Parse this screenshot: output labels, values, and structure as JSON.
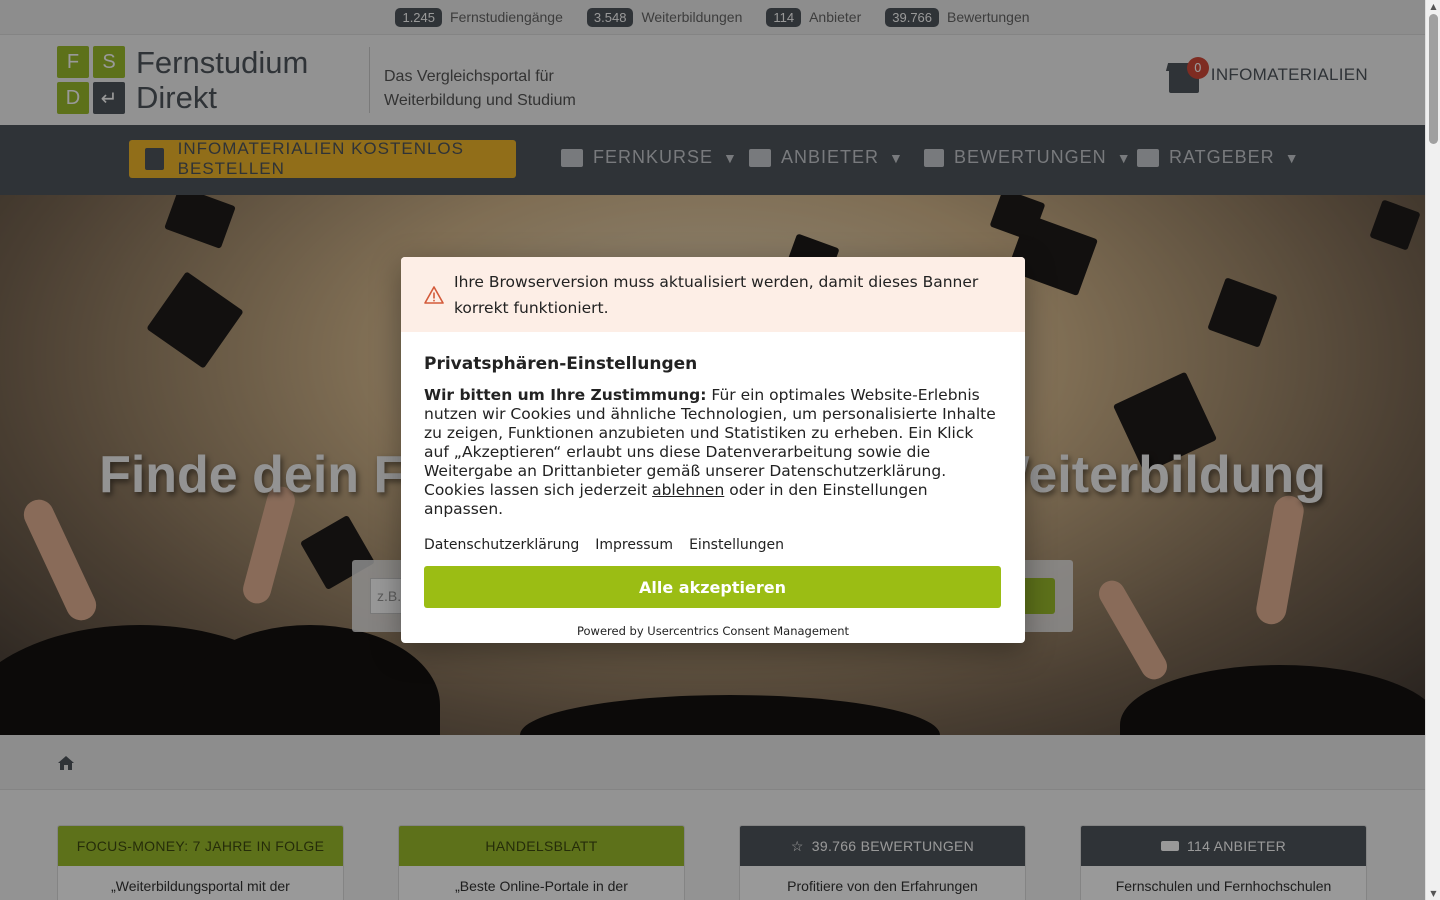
{
  "stats": [
    {
      "num": "1.245",
      "label": "Fernstudiengänge"
    },
    {
      "num": "3.548",
      "label": "Weiterbildungen"
    },
    {
      "num": "114",
      "label": "Anbieter"
    },
    {
      "num": "39.766",
      "label": "Bewertungen"
    }
  ],
  "logo": {
    "letters": [
      "F",
      "S",
      "D",
      "↵"
    ],
    "line1": "Fernstudium",
    "line2": "Direkt"
  },
  "tagline": {
    "line1": "Das Vergleichsportal für",
    "line2": "Weiterbildung und Studium"
  },
  "infomaterial": {
    "label": "INFOMATERIALIEN",
    "count": "0"
  },
  "nav": {
    "cta": "INFOMATERIALIEN KOSTENLOS BESTELLEN",
    "items": [
      "FERNKURSE",
      "ANBIETER",
      "BEWERTUNGEN",
      "RATGEBER"
    ]
  },
  "hero": {
    "title": "Finde dein Fernstudium oder deine Weiterbildung",
    "search_placeholder": "z.B."
  },
  "cards": [
    {
      "head": "FOCUS-MONEY: 7 JAHRE IN FOLGE",
      "body": "„Weiterbildungsportal mit der"
    },
    {
      "head": "HANDELSBLATT",
      "body": "„Beste Online-Portale in der"
    },
    {
      "head": "39.766 BEWERTUNGEN",
      "body": "Profitiere von den Erfahrungen"
    },
    {
      "head": "114 ANBIETER",
      "body": "Fernschulen und Fernhochschulen"
    }
  ],
  "modal": {
    "warning": "Ihre Browserversion muss aktualisiert werden, damit dieses Banner korrekt funktioniert.",
    "title": "Privatsphären-Einstellungen",
    "lead": "Wir bitten um Ihre Zustimmung:",
    "text1": " Für ein optimales Website-Erlebnis nutzen wir Cookies und ähnliche Technologien, um personalisierte Inhalte zu zeigen, Funktionen anzubieten und Statistiken zu erheben. Ein Klick auf „Akzeptieren“ erlaubt uns diese Datenverarbeitung sowie die Weitergabe an Drittanbieter gemäß unserer Datenschutzerklärung. Cookies lassen sich jederzeit ",
    "reject_link": "ablehnen",
    "text2": " oder in den Einstellungen anpassen.",
    "links": [
      "Datenschutzerklärung",
      "Impressum",
      "Einstellungen"
    ],
    "accept": "Alle akzeptieren",
    "powered": "Powered by Usercentrics Consent Management"
  },
  "colors": {
    "green": "#9bbd2c",
    "dark": "#4f555c",
    "yellow": "#f2b82b",
    "badge": "#d34a3a"
  },
  "icons": {
    "home": "home-icon",
    "box": "box-icon",
    "warning": "warning-icon",
    "folder": "folder-icon",
    "cap": "graduation-cap-icon",
    "star": "star-icon",
    "books": "books-icon"
  }
}
